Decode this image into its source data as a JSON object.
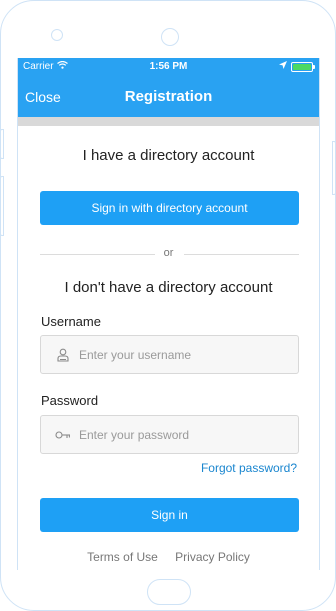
{
  "status_bar": {
    "carrier": "Carrier",
    "time": "1:56 PM",
    "battery_level": 1.0,
    "icons": [
      "wifi-icon",
      "location-arrow-icon",
      "battery-icon"
    ]
  },
  "nav": {
    "close_label": "Close",
    "title": "Registration"
  },
  "directory": {
    "title": "I have a directory account",
    "button_label": "Sign in with directory account"
  },
  "divider": {
    "label": "or"
  },
  "local": {
    "title": "I don't have a directory account",
    "username": {
      "label": "Username",
      "placeholder": "Enter your username",
      "icon": "user-icon"
    },
    "password": {
      "label": "Password",
      "placeholder": "Enter your password",
      "icon": "key-icon"
    },
    "forgot_label": "Forgot password?",
    "signin_label": "Sign in"
  },
  "footer": {
    "terms_label": "Terms of Use",
    "privacy_label": "Privacy Policy"
  },
  "colors": {
    "accent": "#29a2f2",
    "button": "#1ea0f5",
    "link": "#1a86cf",
    "battery_green": "#4cd964"
  }
}
